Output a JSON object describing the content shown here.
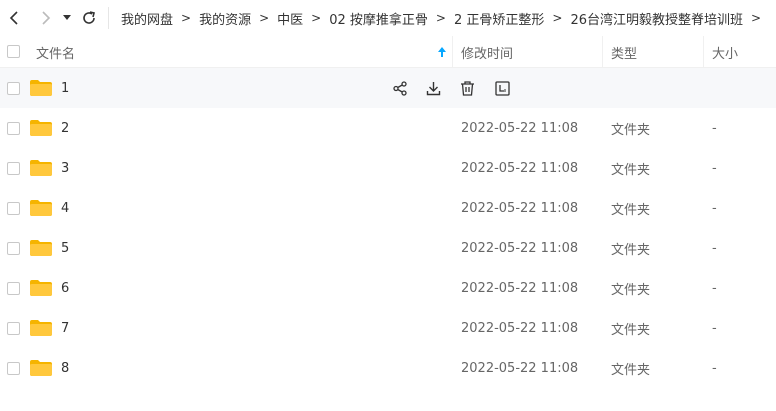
{
  "breadcrumb": [
    {
      "label": "我的网盘"
    },
    {
      "label": "我的资源"
    },
    {
      "label": "中医"
    },
    {
      "label": "02 按摩推拿正骨"
    },
    {
      "label": "2 正骨矫正整形"
    },
    {
      "label": "26台湾江明毅教授整脊培训班"
    }
  ],
  "crumb_separator": ">",
  "table": {
    "headers": {
      "name": "文件名",
      "mtime": "修改时间",
      "type": "类型",
      "size": "大小"
    },
    "sort": {
      "column": "name",
      "direction": "ascending"
    },
    "rows": [
      {
        "name": "1",
        "mtime": "",
        "type": "",
        "size": ""
      },
      {
        "name": "2",
        "mtime": "2022-05-22 11:08",
        "type": "文件夹",
        "size": "-"
      },
      {
        "name": "3",
        "mtime": "2022-05-22 11:08",
        "type": "文件夹",
        "size": "-"
      },
      {
        "name": "4",
        "mtime": "2022-05-22 11:08",
        "type": "文件夹",
        "size": "-"
      },
      {
        "name": "5",
        "mtime": "2022-05-22 11:08",
        "type": "文件夹",
        "size": "-"
      },
      {
        "name": "6",
        "mtime": "2022-05-22 11:08",
        "type": "文件夹",
        "size": "-"
      },
      {
        "name": "7",
        "mtime": "2022-05-22 11:08",
        "type": "文件夹",
        "size": "-"
      },
      {
        "name": "8",
        "mtime": "2022-05-22 11:08",
        "type": "文件夹",
        "size": "-"
      }
    ]
  },
  "row_actions": [
    "share-icon",
    "download-icon",
    "delete-icon",
    "rename-icon"
  ],
  "colors": {
    "folder": "#ffc83d",
    "folder_dark": "#f5b400",
    "sort_arrow": "#06a7ff",
    "hover_row": "#f7f8fa"
  }
}
